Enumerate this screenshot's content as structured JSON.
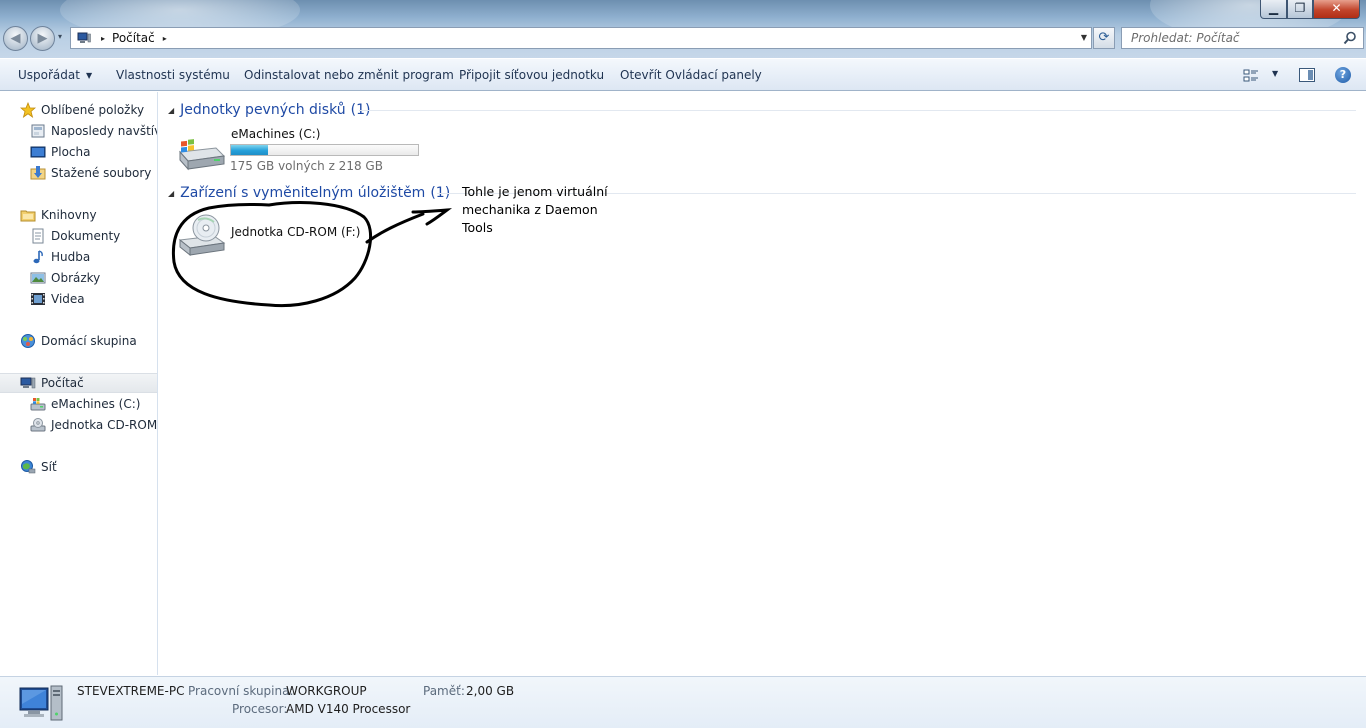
{
  "window": {
    "minimize_glyph": "▁",
    "maximize_glyph": "❐",
    "close_glyph": "✕"
  },
  "navigation": {
    "back_glyph": "◀",
    "forward_glyph": "▶",
    "history_glyph": "▾",
    "address_crumb": "Počítač",
    "crumb_separator": "▸",
    "address_dropdown_glyph": "▼",
    "refresh_glyph": "⟳"
  },
  "search": {
    "placeholder": "Prohledat: Počítač"
  },
  "toolbar": {
    "organize_label": "Uspořádat",
    "organize_arrow": "▼",
    "system_properties_label": "Vlastnosti systému",
    "uninstall_label": "Odinstalovat nebo změnit program",
    "map_drive_label": "Připojit síťovou jednotku",
    "control_panel_label": "Otevřít Ovládací panely",
    "views_arrow": "▼",
    "help_glyph": "?"
  },
  "sidebar": {
    "favorites": {
      "label": "Oblíbené položky",
      "items": [
        {
          "label": "Naposledy navštívené",
          "icon": "recent-places-icon"
        },
        {
          "label": "Plocha",
          "icon": "desktop-icon"
        },
        {
          "label": "Stažené soubory",
          "icon": "downloads-icon"
        }
      ]
    },
    "libraries": {
      "label": "Knihovny",
      "items": [
        {
          "label": "Dokumenty",
          "icon": "documents-icon"
        },
        {
          "label": "Hudba",
          "icon": "music-icon"
        },
        {
          "label": "Obrázky",
          "icon": "pictures-icon"
        },
        {
          "label": "Videa",
          "icon": "videos-icon"
        }
      ]
    },
    "homegroup": {
      "label": "Domácí skupina"
    },
    "computer": {
      "label": "Počítač",
      "items": [
        {
          "label": "eMachines (C:)",
          "icon": "hard-drive-icon"
        },
        {
          "label": "Jednotka CD-ROM (F:)",
          "icon": "cd-drive-icon"
        }
      ]
    },
    "network": {
      "label": "Síť"
    }
  },
  "content": {
    "hard_disks": {
      "title": "Jednotky pevných disků",
      "count": "(1)",
      "collapse_glyph": "◢",
      "drives": [
        {
          "name": "eMachines (C:)",
          "space_text": "175 GB volných z 218 GB",
          "used_fraction": 0.197
        }
      ]
    },
    "removable": {
      "title": "Zařízení s vyměnitelným úložištěm",
      "count": "(1)",
      "collapse_glyph": "◢",
      "drives": [
        {
          "name": "Jednotka CD-ROM (F:)"
        }
      ]
    },
    "annotation": "Tohle je jenom virtuální mechanika z Daemon Tools"
  },
  "details": {
    "computer_name": "STEVEXTREME-PC",
    "workgroup_label": "Pracovní skupina:",
    "workgroup_value": "WORKGROUP",
    "memory_label": "Paměť:",
    "memory_value": "2,00 GB",
    "processor_label": "Procesor:",
    "processor_value": "AMD V140 Processor"
  },
  "colors": {
    "group_title": "#1f4aa5",
    "usage_bar": "#26a0da",
    "annotation_ink": "#000000"
  }
}
